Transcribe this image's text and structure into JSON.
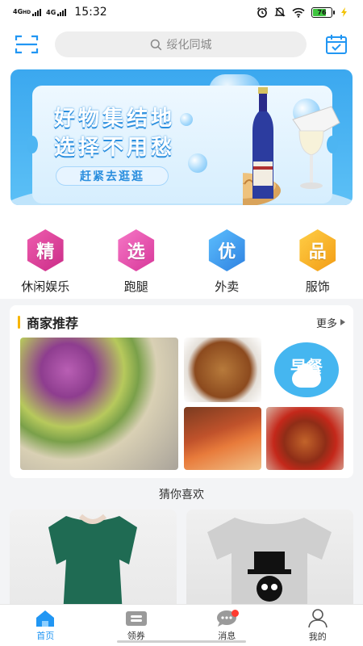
{
  "status_bar": {
    "net1": "4G",
    "net1_sup": "HD",
    "net2": "4G",
    "time": "15:32",
    "battery": "76",
    "battery_level": 0.76
  },
  "search": {
    "placeholder": "绥化同城"
  },
  "banner": {
    "line1": "好物集结地",
    "line2": "选择不用愁",
    "cta": "赶紧去逛逛"
  },
  "categories": [
    {
      "glyph": "精",
      "label": "休闲娱乐",
      "color": "#e63a9a"
    },
    {
      "glyph": "选",
      "label": "跑腿",
      "color": "#ec4fb0"
    },
    {
      "glyph": "优",
      "label": "外卖",
      "color": "#3aa0f0"
    },
    {
      "glyph": "品",
      "label": "服饰",
      "color": "#f5b21c"
    }
  ],
  "merchant": {
    "title": "商家推荐",
    "more": "更多",
    "breakfast": "早餐"
  },
  "guess": {
    "title": "猜你喜欢"
  },
  "tabs": [
    {
      "label": "首页",
      "icon": "home-icon",
      "active": true
    },
    {
      "label": "领券",
      "icon": "coupon-icon",
      "active": false
    },
    {
      "label": "消息",
      "icon": "message-icon",
      "active": false
    },
    {
      "label": "我的",
      "icon": "user-icon",
      "active": false
    }
  ],
  "colors": {
    "accent": "#2196f3",
    "banner_blue": "#3ba8ef",
    "badge_red": "#ff3b30"
  }
}
